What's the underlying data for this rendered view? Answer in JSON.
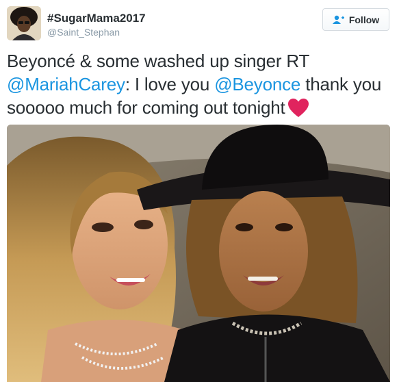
{
  "author": {
    "display_name": "#SugarMama2017",
    "handle": "@Saint_Stephan"
  },
  "follow_button": {
    "label": "Follow"
  },
  "tweet": {
    "intro": "Beyoncé & some washed up singer RT",
    "mention_1": "@MariahCarey",
    "middle": ": I love you",
    "mention_2": "@Beyonce",
    "outro": "thank you sooooo much for coming out tonight"
  },
  "colors": {
    "link": "#1b95e0",
    "text": "#292f33",
    "muted": "#8899a6",
    "heart": "#e0245e"
  },
  "icons": {
    "follow": "add-user-icon",
    "emoji": "red-heart-emoji"
  }
}
